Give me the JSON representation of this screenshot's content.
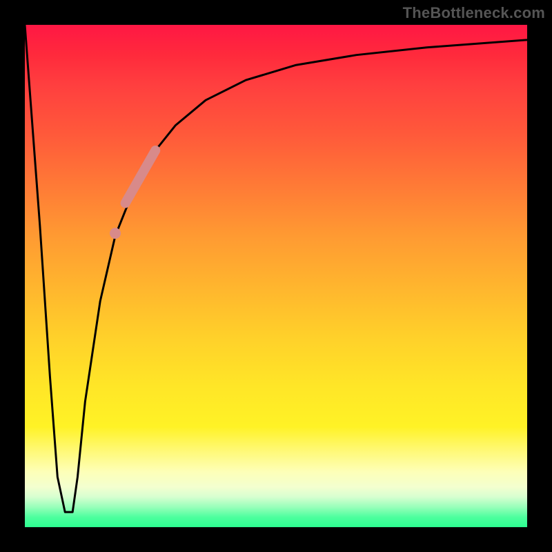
{
  "watermark": "TheBottleneck.com",
  "chart_data": {
    "type": "line",
    "title": "",
    "xlabel": "",
    "ylabel": "",
    "xlim": [
      0,
      100
    ],
    "ylim": [
      0,
      100
    ],
    "grid": false,
    "series": [
      {
        "name": "bottleneck-curve",
        "x": [
          0,
          3,
          5,
          6.5,
          8,
          9.5,
          10.5,
          12,
          15,
          18,
          22,
          26,
          30,
          36,
          44,
          54,
          66,
          80,
          100
        ],
        "y": [
          100,
          60,
          30,
          10,
          3,
          3,
          10,
          25,
          45,
          58,
          68,
          75,
          80,
          85,
          89,
          92,
          94,
          95.5,
          97
        ]
      }
    ],
    "annotations": [
      {
        "name": "marker-highlight",
        "type": "thick-segment",
        "color": "#d88a8a",
        "x": [
          20,
          26
        ],
        "y": [
          64.5,
          75
        ]
      },
      {
        "name": "marker-dot",
        "type": "dot",
        "color": "#d88a8a",
        "x": 18,
        "y": 58.5
      }
    ],
    "background_gradient": {
      "top": "#ff1744",
      "mid": "#ffe627",
      "bottom": "#2cff91"
    }
  }
}
